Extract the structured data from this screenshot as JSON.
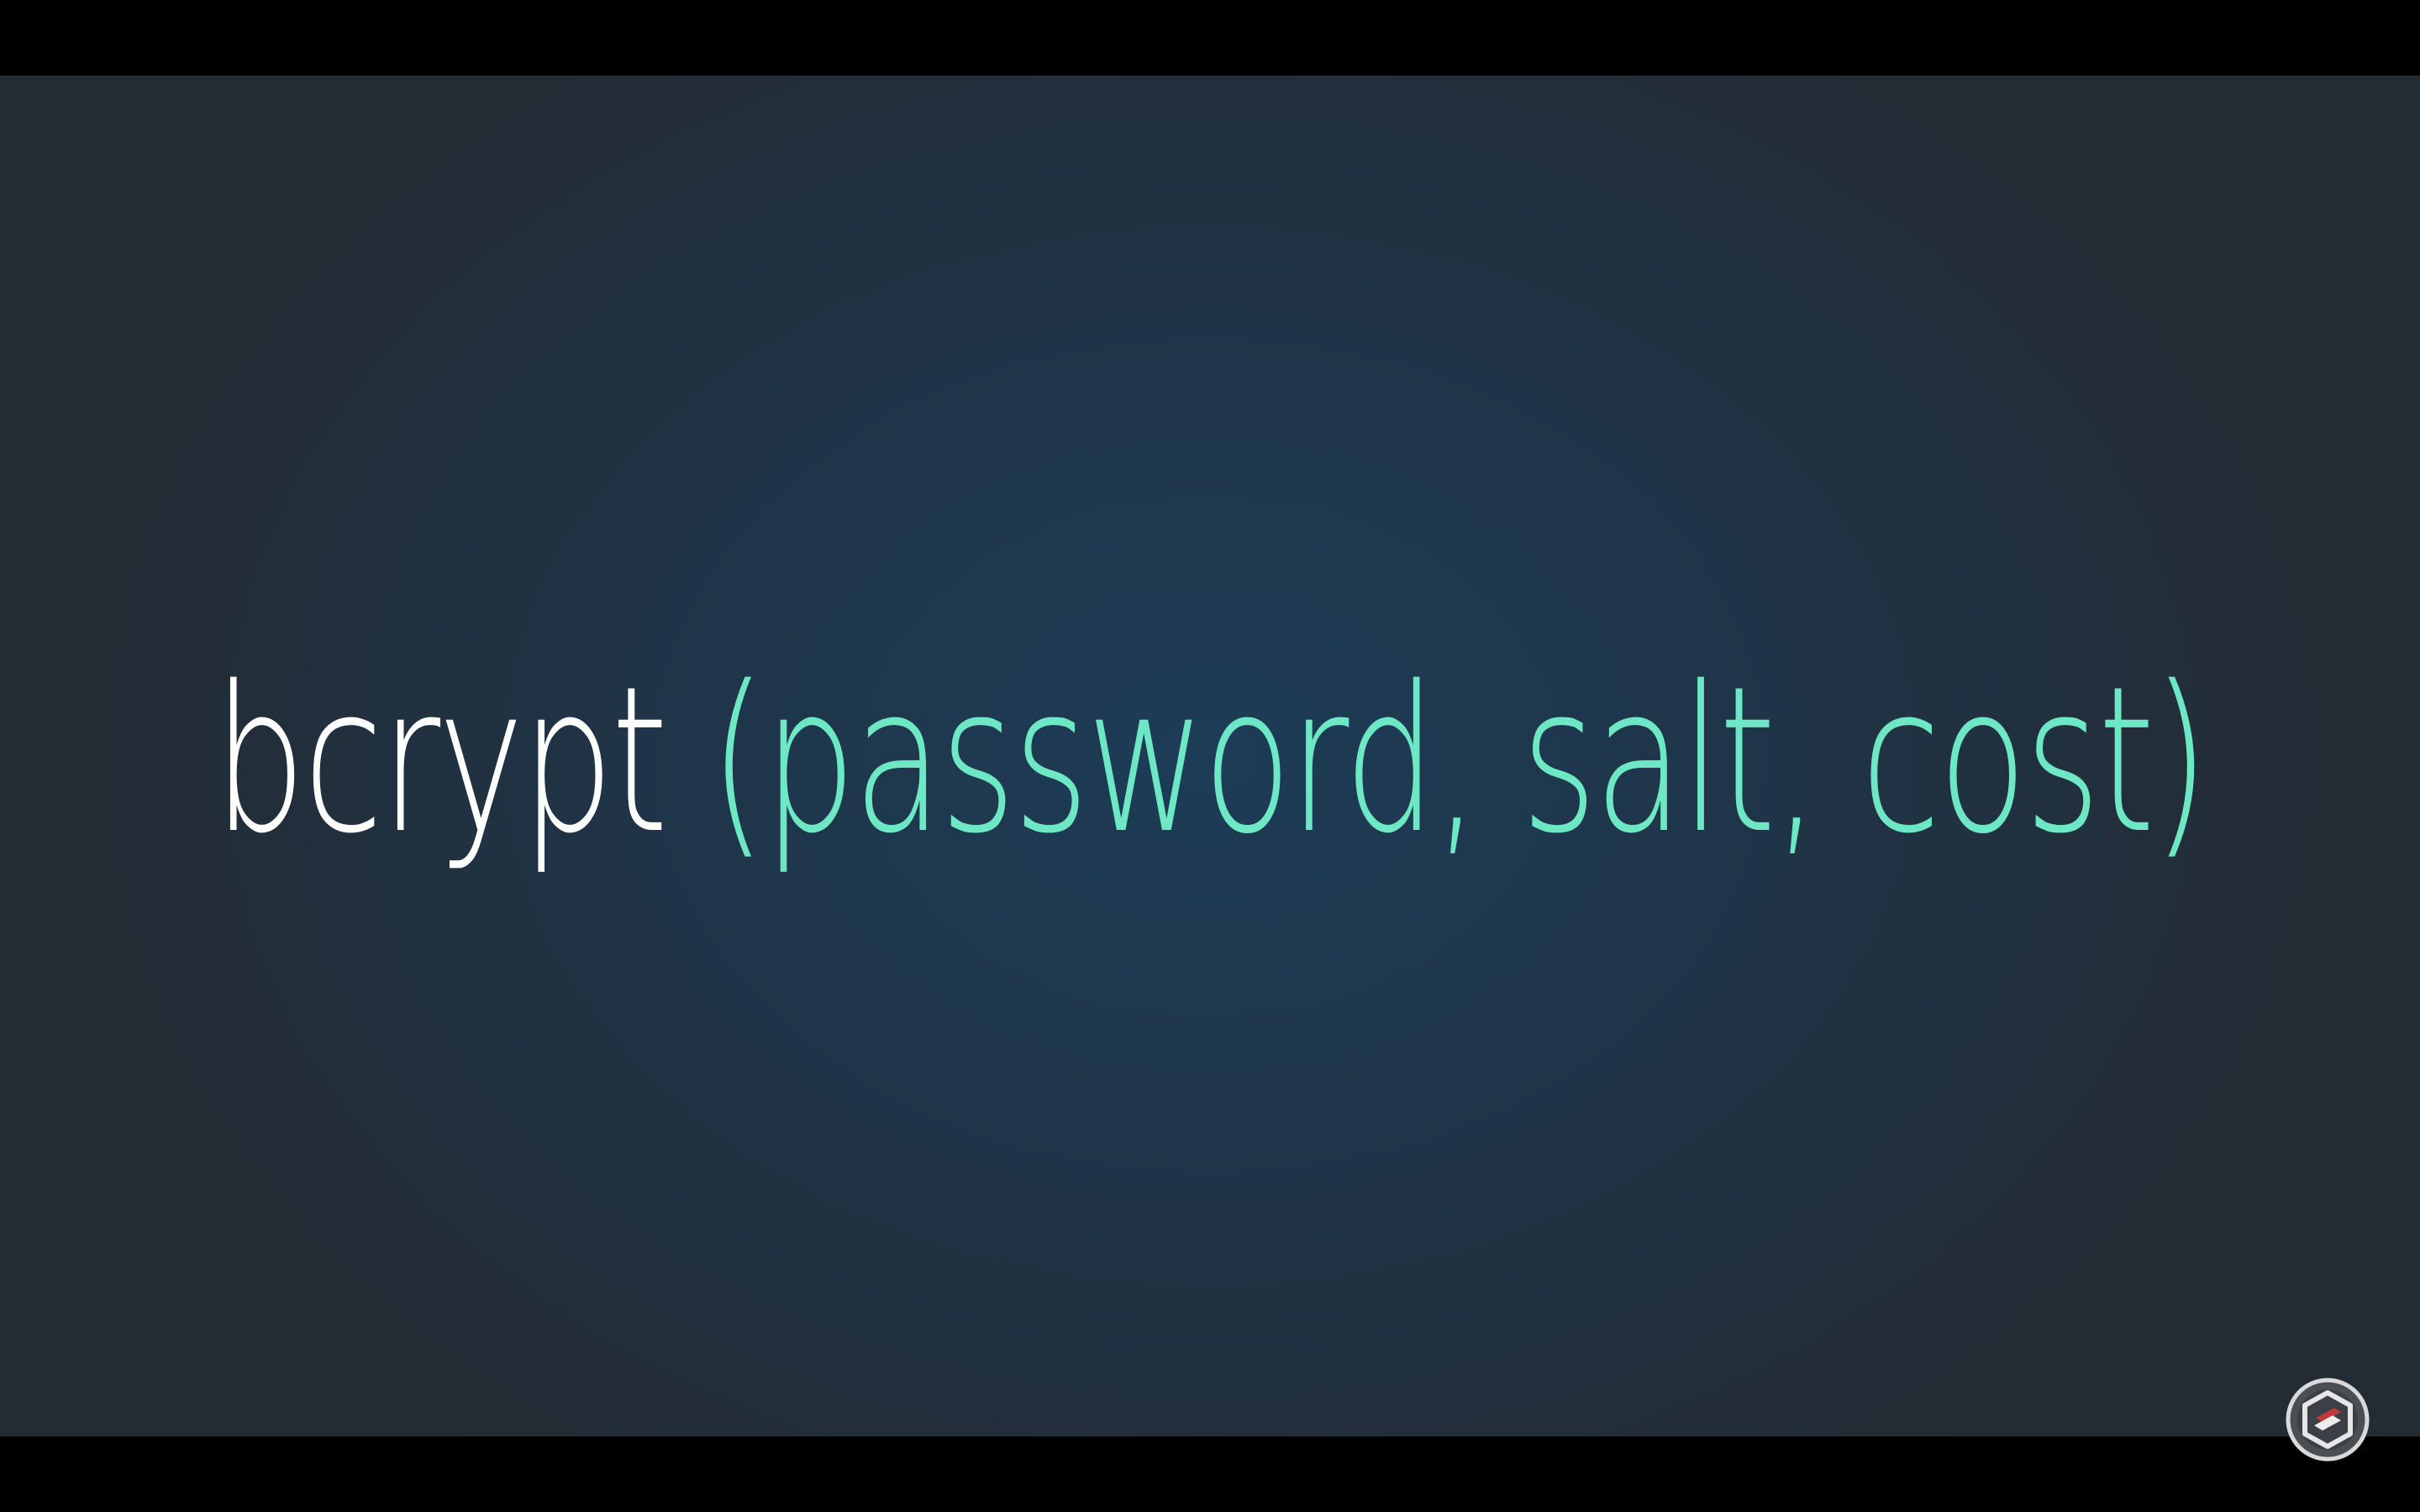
{
  "slide": {
    "function_name": "bcrypt",
    "arguments": "(password, salt, cost)"
  },
  "colors": {
    "function_name": "#ffffff",
    "arguments": "#6ee8c4",
    "background_center": "#1d3c56",
    "background_edge": "#232b33",
    "letterbox": "#000000"
  },
  "watermark": {
    "icon": "channel-logo-icon"
  }
}
